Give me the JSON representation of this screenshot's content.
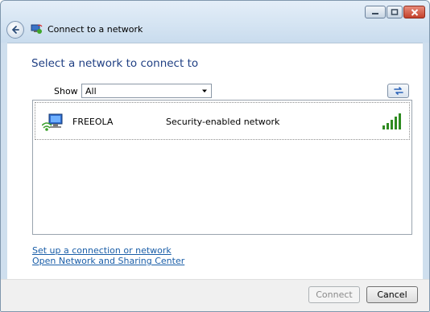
{
  "window": {
    "title": "Connect to a network"
  },
  "main": {
    "heading": "Select a network to connect to",
    "show_label": "Show",
    "filter": {
      "selected": "All"
    }
  },
  "networks": [
    {
      "name": "FREEOLA",
      "security": "Security-enabled network",
      "signal_bars": 5
    }
  ],
  "links": {
    "setup": "Set up a connection or network",
    "sharing_center": "Open Network and Sharing Center"
  },
  "buttons": {
    "connect": "Connect",
    "cancel": "Cancel"
  },
  "icons": {
    "back": "back-arrow-icon",
    "title": "network-connect-icon",
    "refresh": "refresh-icon",
    "network": "wireless-network-icon",
    "signal": "signal-strength-icon"
  },
  "colors": {
    "heading": "#1f3f83",
    "link": "#1a5ea8",
    "signal": "#2e8b20"
  }
}
